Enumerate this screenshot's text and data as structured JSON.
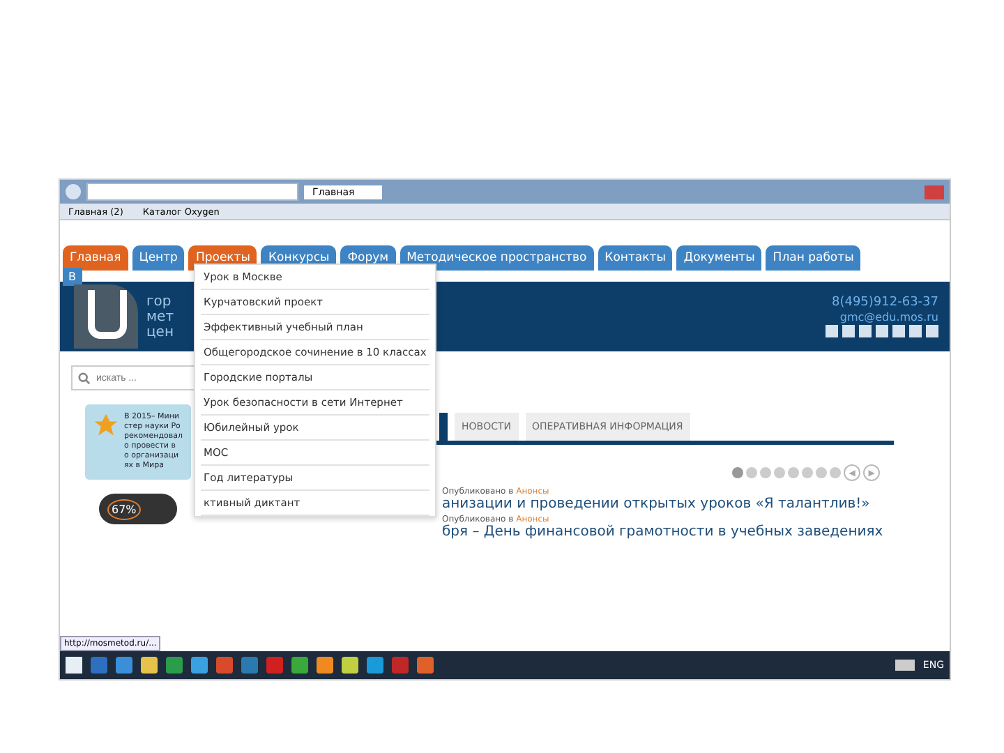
{
  "browser": {
    "tabs": [
      {
        "title": "Главная",
        "selected": true
      }
    ],
    "bookmarks": [
      "Главная (2)",
      "Каталог Oxygen"
    ]
  },
  "nav": [
    {
      "label": "Главная",
      "selected": true
    },
    {
      "label": "Центр",
      "selected": false
    },
    {
      "label": "Проекты",
      "selected": true
    },
    {
      "label": "Конкурсы",
      "selected": false
    },
    {
      "label": "Форум",
      "selected": false
    },
    {
      "label": "Методическое пространство",
      "selected": false
    },
    {
      "label": "Контакты",
      "selected": false
    },
    {
      "label": "Документы",
      "selected": false
    },
    {
      "label": "План работы",
      "selected": false
    }
  ],
  "dropdown": [
    "Урок в Москве",
    "Курчатовский проект",
    "Эффективный учебный план",
    "Общегородское сочинение в 10 классах",
    "Городские порталы",
    "Урок безопасности в сети Интернет",
    "Юбилейный урок",
    "МОС",
    "Год литературы",
    "ктивный диктант"
  ],
  "header": {
    "badge": "В",
    "logo_lines": [
      "гор",
      "мет",
      "цен"
    ],
    "phone": "8(495)912-63-37",
    "email": "gmc@edu.mos.ru"
  },
  "search": {
    "placeholder": "искать ..."
  },
  "notice": "В 2015– Министер науки Ро рекомендовало провести в о организациях в Мира",
  "gauge": "67%",
  "content_tabs": [
    {
      "selected": true
    },
    {
      "label": "НОВОСТИ",
      "selected": false
    },
    {
      "label": "ОПЕРАТИВНАЯ ИНФОРМАЦИЯ",
      "selected": false
    }
  ],
  "slider_dots": [
    {
      "selected": true
    },
    {
      "selected": false
    },
    {
      "selected": false
    },
    {
      "selected": false
    },
    {
      "selected": false
    },
    {
      "selected": false
    },
    {
      "selected": false
    },
    {
      "selected": false
    }
  ],
  "slider_arrows": [
    "◀",
    "▶"
  ],
  "posts": [
    {
      "meta": "Опубликовано в",
      "category": "Анонсы",
      "title": "анизации и проведении открытых уроков «Я талантлив!»"
    },
    {
      "meta": "Опубликовано в",
      "category": "Анонсы",
      "title": "бря – День финансовой грамотности в учебных заведениях"
    }
  ],
  "status_url": "http://mosmetod.ru/...",
  "taskbar": {
    "lang": "ENG"
  }
}
